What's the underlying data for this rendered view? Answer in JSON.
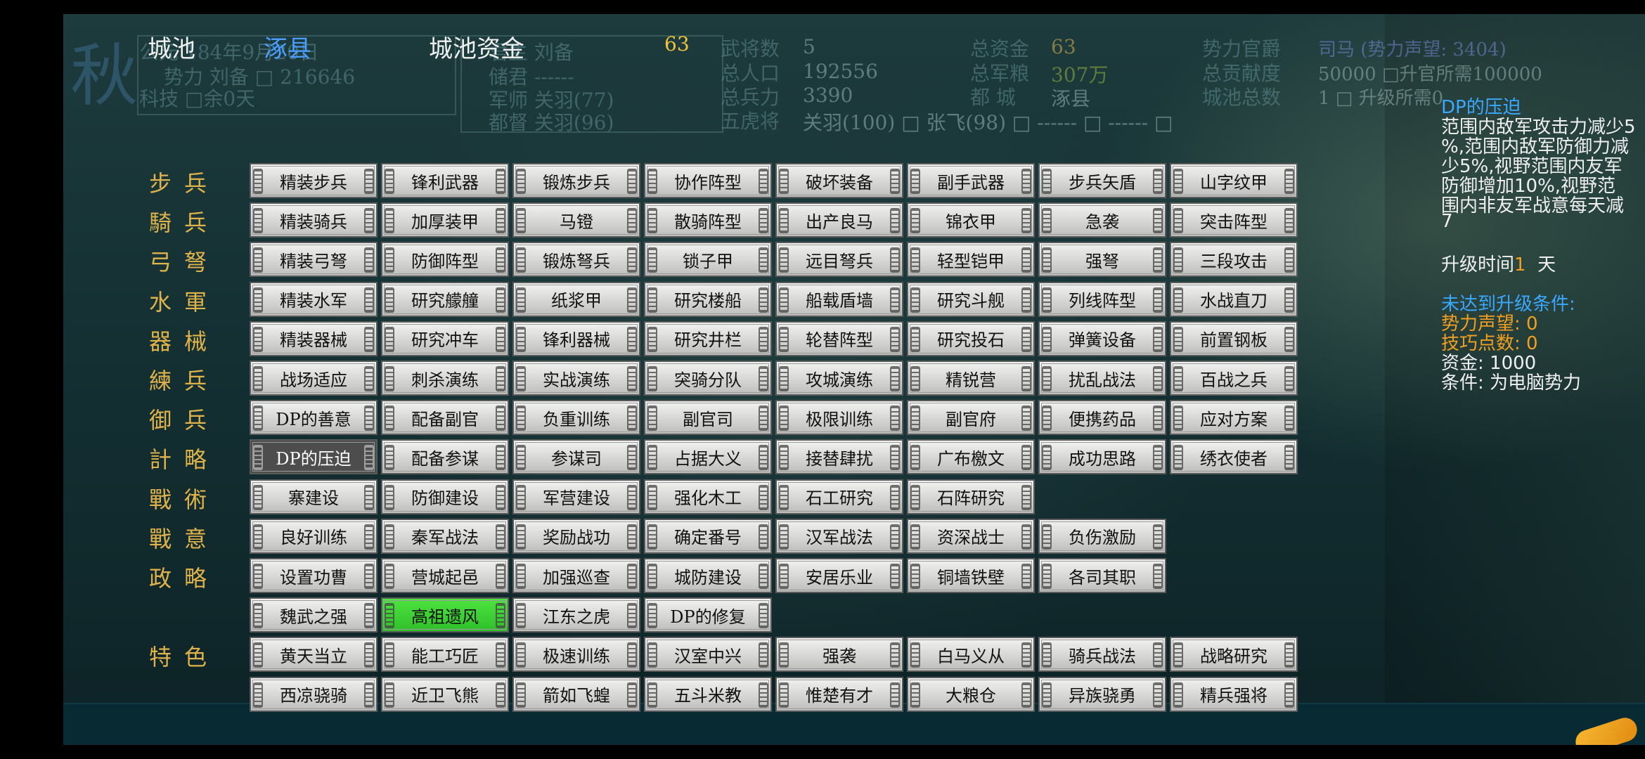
{
  "header": {
    "city_label": "城池",
    "city_name": "涿县",
    "funds_label": "城池资金",
    "funds_value": "63"
  },
  "faded_info": {
    "season": "秋",
    "date": "公元 184年9月20日",
    "force": "势力 刘备 □ 216646",
    "tech": "科技 □余0天",
    "lord": "君主 刘备",
    "heir": "储君 ------",
    "strategist": "军师 关羽(77)",
    "commander": "都督 关羽(96)",
    "generals_label": "武将数",
    "generals_value": "5",
    "population_label": "总人口",
    "population_value": "192556",
    "troops_label": "总兵力",
    "troops_value": "3390",
    "tigers_label": "五虎将",
    "tigers_value": "关羽(100) □ 张飞(98) □ ------ □ ------ □",
    "total_funds_label": "总资金",
    "total_funds_value": "63",
    "total_food_label": "总军粮",
    "total_food_value": "307万",
    "capital_label": "都 城",
    "capital_value": "涿县",
    "rank_label": "势力官爵",
    "rank_value": "司马 (势力声望: 3404)",
    "contribution_label": "总贡献度",
    "contribution_value": "50000 □升官所需100000",
    "cities_label": "城池总数",
    "cities_value": "1 □ 升级所需0"
  },
  "categories": [
    {
      "label": "步兵",
      "items": [
        "精装步兵",
        "锋利武器",
        "锻炼步兵",
        "协作阵型",
        "破坏装备",
        "副手武器",
        "步兵矢盾",
        "山字纹甲"
      ]
    },
    {
      "label": "騎兵",
      "items": [
        "精装骑兵",
        "加厚装甲",
        "马镫",
        "散骑阵型",
        "出产良马",
        "锦衣甲",
        "急袭",
        "突击阵型"
      ]
    },
    {
      "label": "弓弩",
      "items": [
        "精装弓弩",
        "防御阵型",
        "锻炼弩兵",
        "锁子甲",
        "远目弩兵",
        "轻型铠甲",
        "强弩",
        "三段攻击"
      ]
    },
    {
      "label": "水軍",
      "items": [
        "精装水军",
        "研究艨艟",
        "纸浆甲",
        "研究楼船",
        "船载盾墙",
        "研究斗舰",
        "列线阵型",
        "水战直刀"
      ]
    },
    {
      "label": "器械",
      "items": [
        "精装器械",
        "研究冲车",
        "锋利器械",
        "研究井栏",
        "轮替阵型",
        "研究投石",
        "弹簧设备",
        "前置钢板"
      ]
    },
    {
      "label": "練兵",
      "items": [
        "战场适应",
        "刺杀演练",
        "实战演练",
        "突骑分队",
        "攻城演练",
        "精锐营",
        "扰乱战法",
        "百战之兵"
      ]
    },
    {
      "label": "御兵",
      "items": [
        "DP的善意",
        "配备副官",
        "负重训练",
        "副官司",
        "极限训练",
        "副官府",
        "便携药品",
        "应对方案"
      ]
    },
    {
      "label": "計略",
      "items": [
        "DP的压迫",
        "配备参谋",
        "参谋司",
        "占据大义",
        "接替肆扰",
        "广布檄文",
        "成功思路",
        "绣衣使者"
      ]
    },
    {
      "label": "戰術",
      "items": [
        "寨建设",
        "防御建设",
        "军营建设",
        "强化木工",
        "石工研究",
        "石阵研究"
      ]
    },
    {
      "label": "戰意",
      "items": [
        "良好训练",
        "秦军战法",
        "奖励战功",
        "确定番号",
        "汉军战法",
        "资深战士",
        "负伤激励"
      ]
    },
    {
      "label": "政略",
      "items": [
        "设置功曹",
        "营城起邑",
        "加强巡查",
        "城防建设",
        "安居乐业",
        "铜墙铁壁",
        "各司其职"
      ]
    },
    {
      "label": "",
      "items": [
        "魏武之强",
        "高祖遗风",
        "江东之虎",
        "DP的修复"
      ]
    },
    {
      "label": "特色",
      "items": [
        "黄天当立",
        "能工巧匠",
        "极速训练",
        "汉室中兴",
        "强袭",
        "白马义从",
        "骑兵战法",
        "战略研究"
      ]
    },
    {
      "label": "",
      "items": [
        "西凉骁骑",
        "近卫飞熊",
        "箭如飞蝗",
        "五斗米教",
        "惟楚有才",
        "大粮仓",
        "异族骁勇",
        "精兵强将"
      ]
    }
  ],
  "selected_item": "DP的压迫",
  "highlighted_item": "高祖遗风",
  "detail": {
    "title": "DP的压迫",
    "desc": [
      "范围内敌军攻击力减少5",
      "%,范围内敌军防御力减",
      "少5%,视野范围内友军",
      "防御增加10%,视野范",
      "围内非友军战意每天减",
      "7"
    ],
    "upgrade_time_label": "升级时间",
    "upgrade_time_value": "1",
    "upgrade_time_unit": "天",
    "cond_title": "未达到升级条件:",
    "cond_prestige": "势力声望: 0",
    "cond_skill": "技巧点数: 0",
    "cond_funds": "资金: 1000",
    "cond_ai": "条件: 为电脑势力"
  },
  "colors": {
    "label_gold": "#e0b24a",
    "header_blue": "#4a9eff",
    "funds_gold": "#f0c23a",
    "highlight_green": "#3bd12f",
    "selected_gray": "#4d4d4d"
  }
}
